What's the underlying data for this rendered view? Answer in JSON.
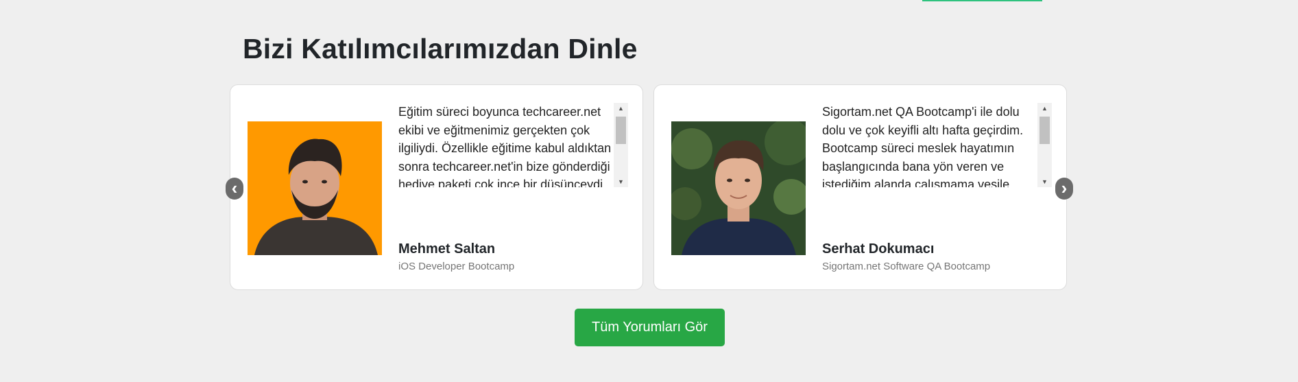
{
  "section": {
    "title": "Bizi Katılımcılarımızdan Dinle"
  },
  "carousel": {
    "prev_icon": "‹",
    "next_icon": "›",
    "scroll_up": "▲",
    "scroll_down": "▼",
    "testimonials": [
      {
        "quote": "Eğitim süreci boyunca techcareer.net ekibi ve eğitmenimiz gerçekten çok ilgiliydi. Özellikle eğitime kabul aldıktan sonra techcareer.net'in bize gönderdiği hediye paketi çok ince bir düşünceydi.",
        "name": "Mehmet Saltan",
        "program": "iOS Developer Bootcamp",
        "photo_background": "#ff9900"
      },
      {
        "quote": "Sigortam.net QA Bootcamp'i ile dolu dolu ve çok keyifli altı hafta geçirdim. Bootcamp süreci meslek hayatımın başlangıcında bana yön veren ve istediğim alanda çalışmama vesile olan",
        "name": "Serhat Dokumacı",
        "program": "Sigortam.net Software QA Bootcamp",
        "photo_background": "#2f4a2a"
      }
    ]
  },
  "actions": {
    "all_reviews_label": "Tüm Yorumları Gör"
  },
  "colors": {
    "page_background": "#efefef",
    "accent_green": "#28a745",
    "top_accent": "#2ec27e"
  }
}
